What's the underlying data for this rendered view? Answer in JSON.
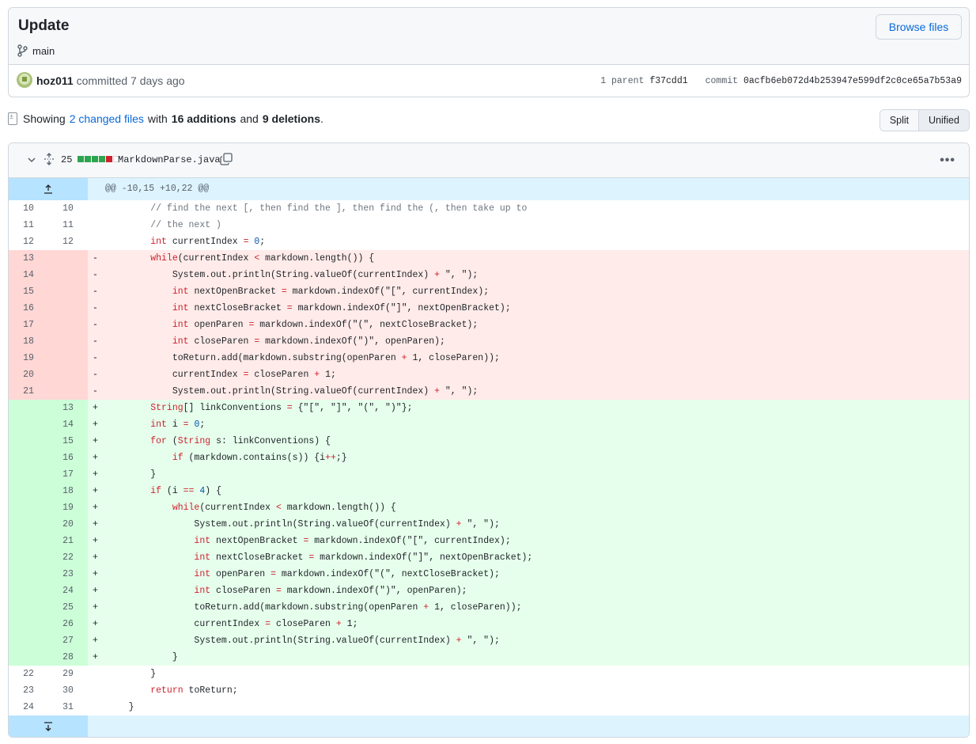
{
  "commit": {
    "title": "Update",
    "branch": "main",
    "browse_files_label": "Browse files",
    "author": "hoz011",
    "committed_text": "committed 7 days ago",
    "parent_label": "1 parent",
    "parent_sha": "f37cdd1",
    "commit_label": "commit",
    "commit_sha": "0acfb6eb072d4b253947e599df2c0ce65a7b53a9"
  },
  "summary": {
    "showing": "Showing",
    "changed_files": "2 changed files",
    "with": "with",
    "additions": "16 additions",
    "and": "and",
    "deletions": "9 deletions",
    "period": "."
  },
  "view_toggle": {
    "split": "Split",
    "unified": "Unified",
    "selected": "Unified"
  },
  "file": {
    "changes_count": "25",
    "diffstat": [
      "add",
      "add",
      "add",
      "add",
      "del",
      "neutral"
    ],
    "name": "MarkdownParse.java",
    "hunk_header": "@@ -10,15 +10,22 @@"
  },
  "colors": {
    "link": "#0969da",
    "addition_bg": "#e6ffec",
    "addition_gutter": "#ccffd8",
    "deletion_bg": "#ffebe9",
    "deletion_gutter": "#ffd7d5",
    "hunk_bg": "#ddf4ff",
    "keyword": "#cf222e"
  },
  "lines": [
    {
      "type": "ctx",
      "old": "10",
      "new": "10",
      "sign": "",
      "code": "        // find the next [, then find the ], then find the (, then take up to"
    },
    {
      "type": "ctx",
      "old": "11",
      "new": "11",
      "sign": "",
      "code": "        // the next )"
    },
    {
      "type": "ctx",
      "old": "12",
      "new": "12",
      "sign": "",
      "code": "        int currentIndex = 0;"
    },
    {
      "type": "del",
      "old": "13",
      "new": "",
      "sign": "-",
      "code": "        while(currentIndex < markdown.length()) {"
    },
    {
      "type": "del",
      "old": "14",
      "new": "",
      "sign": "-",
      "code": "            System.out.println(String.valueOf(currentIndex) + \", \");"
    },
    {
      "type": "del",
      "old": "15",
      "new": "",
      "sign": "-",
      "code": "            int nextOpenBracket = markdown.indexOf(\"[\", currentIndex);"
    },
    {
      "type": "del",
      "old": "16",
      "new": "",
      "sign": "-",
      "code": "            int nextCloseBracket = markdown.indexOf(\"]\", nextOpenBracket);"
    },
    {
      "type": "del",
      "old": "17",
      "new": "",
      "sign": "-",
      "code": "            int openParen = markdown.indexOf(\"(\", nextCloseBracket);"
    },
    {
      "type": "del",
      "old": "18",
      "new": "",
      "sign": "-",
      "code": "            int closeParen = markdown.indexOf(\")\", openParen);"
    },
    {
      "type": "del",
      "old": "19",
      "new": "",
      "sign": "-",
      "code": "            toReturn.add(markdown.substring(openParen + 1, closeParen));"
    },
    {
      "type": "del",
      "old": "20",
      "new": "",
      "sign": "-",
      "code": "            currentIndex = closeParen + 1;"
    },
    {
      "type": "del",
      "old": "21",
      "new": "",
      "sign": "-",
      "code": "            System.out.println(String.valueOf(currentIndex) + \", \");"
    },
    {
      "type": "add",
      "old": "",
      "new": "13",
      "sign": "+",
      "code": "        String[] linkConventions = {\"[\", \"]\", \"(\", \")\"};"
    },
    {
      "type": "add",
      "old": "",
      "new": "14",
      "sign": "+",
      "code": "        int i = 0;"
    },
    {
      "type": "add",
      "old": "",
      "new": "15",
      "sign": "+",
      "code": "        for (String s: linkConventions) {"
    },
    {
      "type": "add",
      "old": "",
      "new": "16",
      "sign": "+",
      "code": "            if (markdown.contains(s)) {i++;}"
    },
    {
      "type": "add",
      "old": "",
      "new": "17",
      "sign": "+",
      "code": "        }"
    },
    {
      "type": "add",
      "old": "",
      "new": "18",
      "sign": "+",
      "code": "        if (i == 4) {"
    },
    {
      "type": "add",
      "old": "",
      "new": "19",
      "sign": "+",
      "code": "            while(currentIndex < markdown.length()) {"
    },
    {
      "type": "add",
      "old": "",
      "new": "20",
      "sign": "+",
      "code": "                System.out.println(String.valueOf(currentIndex) + \", \");"
    },
    {
      "type": "add",
      "old": "",
      "new": "21",
      "sign": "+",
      "code": "                int nextOpenBracket = markdown.indexOf(\"[\", currentIndex);"
    },
    {
      "type": "add",
      "old": "",
      "new": "22",
      "sign": "+",
      "code": "                int nextCloseBracket = markdown.indexOf(\"]\", nextOpenBracket);"
    },
    {
      "type": "add",
      "old": "",
      "new": "23",
      "sign": "+",
      "code": "                int openParen = markdown.indexOf(\"(\", nextCloseBracket);"
    },
    {
      "type": "add",
      "old": "",
      "new": "24",
      "sign": "+",
      "code": "                int closeParen = markdown.indexOf(\")\", openParen);"
    },
    {
      "type": "add",
      "old": "",
      "new": "25",
      "sign": "+",
      "code": "                toReturn.add(markdown.substring(openParen + 1, closeParen));"
    },
    {
      "type": "add",
      "old": "",
      "new": "26",
      "sign": "+",
      "code": "                currentIndex = closeParen + 1;"
    },
    {
      "type": "add",
      "old": "",
      "new": "27",
      "sign": "+",
      "code": "                System.out.println(String.valueOf(currentIndex) + \", \");"
    },
    {
      "type": "add",
      "old": "",
      "new": "28",
      "sign": "+",
      "code": "            }"
    },
    {
      "type": "ctx",
      "old": "22",
      "new": "29",
      "sign": "",
      "code": "        }"
    },
    {
      "type": "ctx",
      "old": "23",
      "new": "30",
      "sign": "",
      "code": "        return toReturn;"
    },
    {
      "type": "ctx",
      "old": "24",
      "new": "31",
      "sign": "",
      "code": "    }"
    }
  ]
}
